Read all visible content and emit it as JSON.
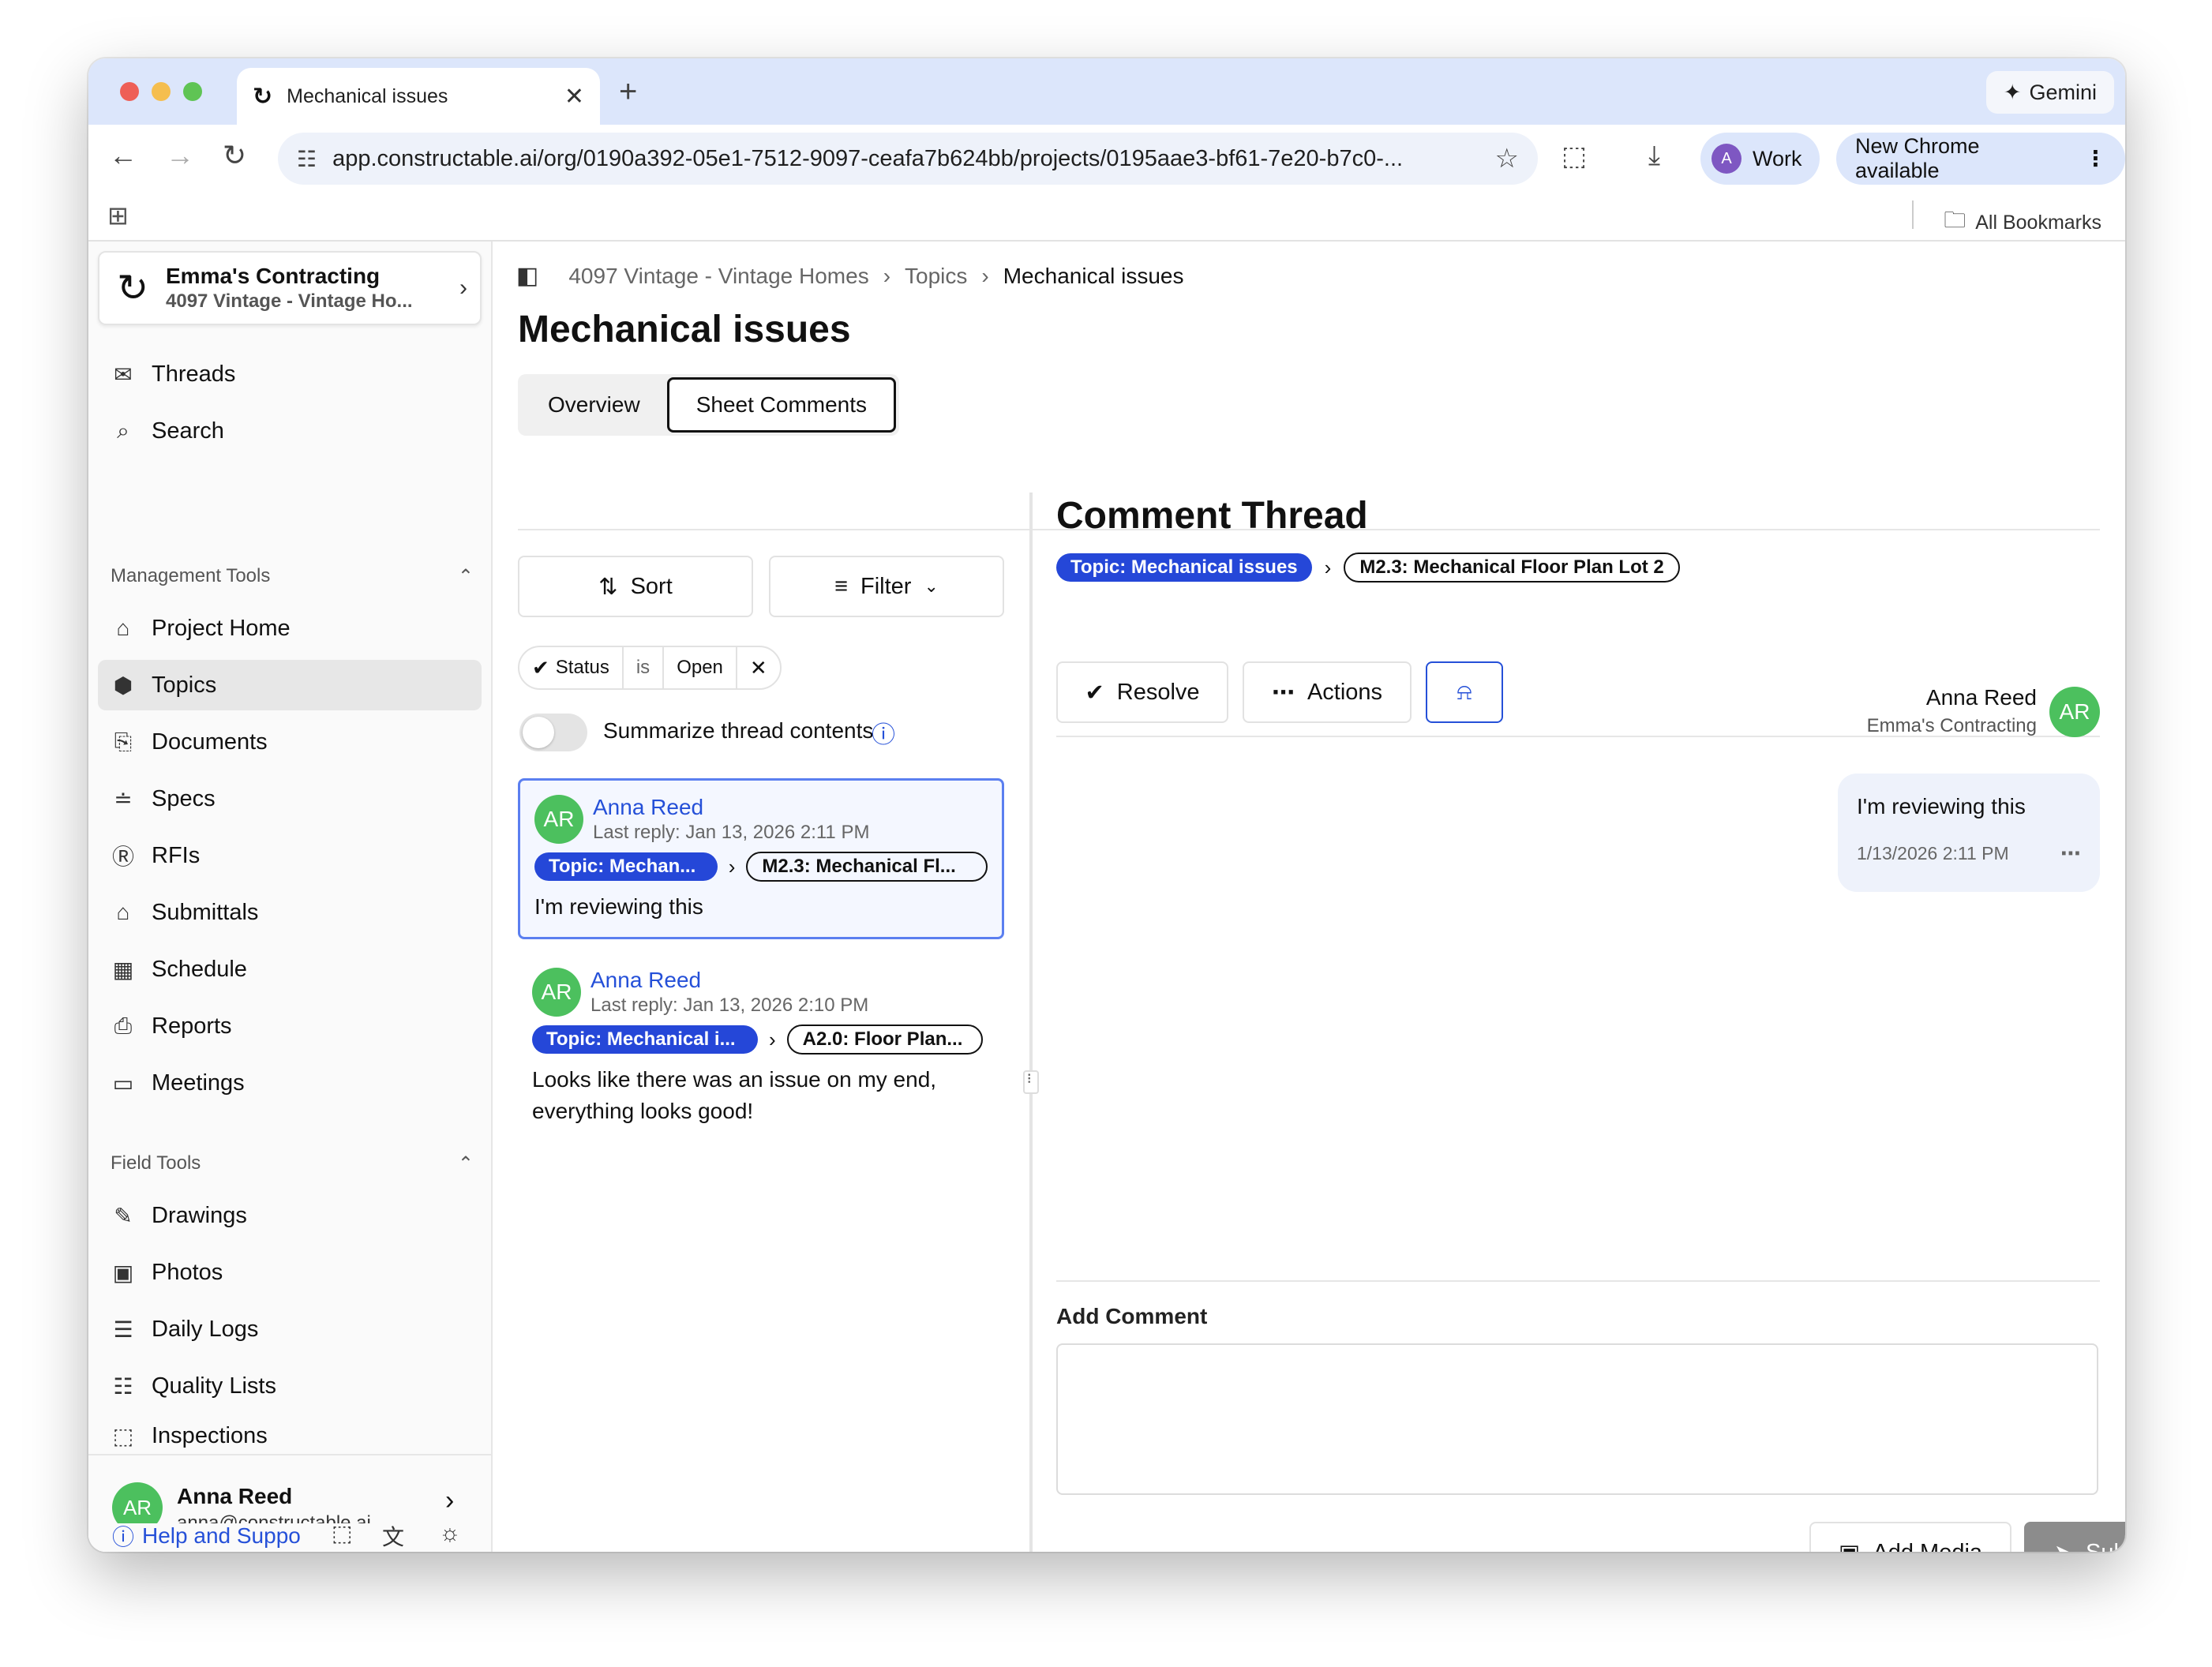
{
  "browser": {
    "tab_title": "Mechanical issues",
    "gemini_label": "Gemini",
    "url": "app.constructable.ai/org/0190a392-05e1-7512-9097-ceafa7b624bb/projects/0195aae3-bf61-7e20-b7c0-...",
    "profile_initial": "A",
    "profile_label": "Work",
    "update_label": "New Chrome available",
    "bookmarks_label": "All Bookmarks"
  },
  "sidebar": {
    "org_name": "Emma's Contracting",
    "project_name": "4097 Vintage - Vintage Ho...",
    "top_items": [
      {
        "label": "Threads",
        "icon": "inbox-icon"
      },
      {
        "label": "Search",
        "icon": "search-icon"
      }
    ],
    "management_title": "Management Tools",
    "management_items": [
      {
        "label": "Project Home",
        "icon": "home-icon"
      },
      {
        "label": "Topics",
        "icon": "layers-icon"
      },
      {
        "label": "Documents",
        "icon": "documents-icon"
      },
      {
        "label": "Specs",
        "icon": "specs-icon"
      },
      {
        "label": "RFIs",
        "icon": "rfi-icon"
      },
      {
        "label": "Submittals",
        "icon": "stamp-icon"
      },
      {
        "label": "Schedule",
        "icon": "calendar-icon"
      },
      {
        "label": "Reports",
        "icon": "report-icon"
      },
      {
        "label": "Meetings",
        "icon": "presentation-icon"
      }
    ],
    "field_title": "Field Tools",
    "field_items": [
      {
        "label": "Drawings",
        "icon": "drawing-icon"
      },
      {
        "label": "Photos",
        "icon": "photos-icon"
      },
      {
        "label": "Daily Logs",
        "icon": "daily-log-icon"
      },
      {
        "label": "Quality Lists",
        "icon": "list-checks-icon"
      },
      {
        "label": "Inspections",
        "icon": "inspection-icon"
      }
    ],
    "user": {
      "initials": "AR",
      "name": "Anna Reed",
      "email": "anna@constructable.ai"
    },
    "help_label": "Help and Suppo"
  },
  "main": {
    "breadcrumbs": [
      "4097 Vintage - Vintage Homes",
      "Topics",
      "Mechanical issues"
    ],
    "title": "Mechanical issues",
    "tabs": [
      "Overview",
      "Sheet Comments"
    ],
    "sort_label": "Sort",
    "filter_label": "Filter",
    "filter_chip": {
      "field": "Status",
      "op": "is",
      "value": "Open"
    },
    "summarize_label": "Summarize thread contents",
    "threads": [
      {
        "initials": "AR",
        "author": "Anna Reed",
        "last_reply": "Last reply: Jan 13, 2026 2:11 PM",
        "topic": "Topic: Mechan...",
        "sheet": "M2.3: Mechanical Fl...",
        "body": "I'm reviewing this"
      },
      {
        "initials": "AR",
        "author": "Anna Reed",
        "last_reply": "Last reply: Jan 13, 2026 2:10 PM",
        "topic": "Topic: Mechanical i...",
        "sheet": "A2.0: Floor Plan...",
        "body": "Looks like there was an issue on my end, everything looks good!"
      }
    ],
    "comment_thread": {
      "title": "Comment Thread",
      "topic_tag": "Topic: Mechanical issues",
      "sheet_tag": "M2.3: Mechanical Floor Plan Lot 2",
      "resolve_label": "Resolve",
      "actions_label": "Actions",
      "message": {
        "author": "Anna Reed",
        "company": "Emma's Contracting",
        "initials": "AR",
        "text": "I'm reviewing this",
        "timestamp": "1/13/2026 2:11 PM"
      },
      "add_comment_label": "Add Comment",
      "add_media_label": "Add Media",
      "submit_label": "Submit"
    }
  }
}
